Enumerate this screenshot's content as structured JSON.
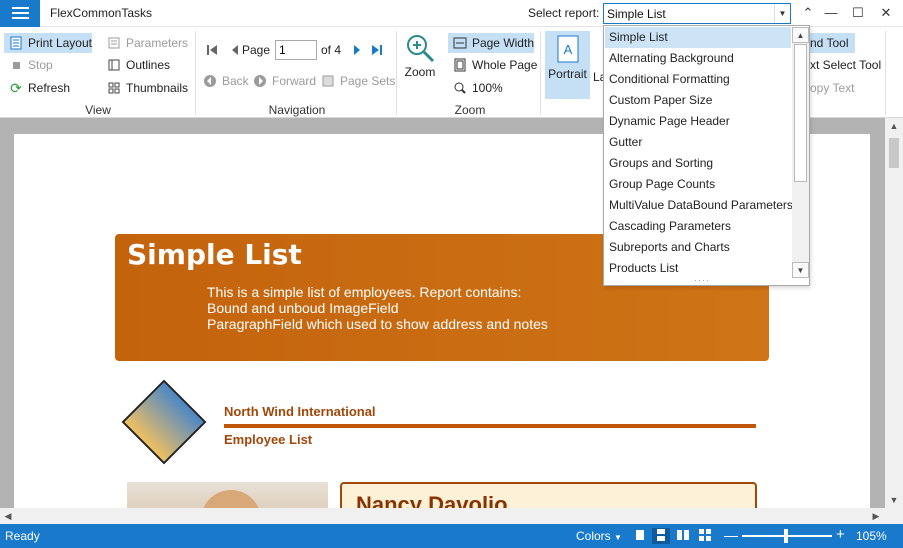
{
  "app": {
    "title": "FlexCommonTasks"
  },
  "header": {
    "select_label": "Select report:",
    "selected_report": "Simple List"
  },
  "ribbon": {
    "view": {
      "print_layout": "Print Layout",
      "stop": "Stop",
      "refresh": "Refresh",
      "parameters": "Parameters",
      "outlines": "Outlines",
      "thumbnails": "Thumbnails",
      "group_label": "View"
    },
    "navigation": {
      "page_label": "Page",
      "page_value": "1",
      "page_of": "of 4",
      "back": "Back",
      "forward": "Forward",
      "page_sets": "Page Sets",
      "group_label": "Navigation"
    },
    "zoom": {
      "zoom": "Zoom",
      "page_width": "Page Width",
      "whole_page": "Whole Page",
      "percent_100": "100%",
      "group_label": "Zoom"
    },
    "layout": {
      "portrait": "Portrait",
      "landscape_partial": "La"
    },
    "tools": {
      "hand_tool_partial": "nd Tool",
      "select_tool_partial": "xt Select Tool",
      "copy_text_partial": "opy Text"
    }
  },
  "dropdown": {
    "items": [
      "Simple List",
      "Alternating Background",
      "Conditional Formatting",
      "Custom Paper Size",
      "Dynamic Page Header",
      "Gutter",
      "Groups and Sorting",
      "Group Page Counts",
      "MultiValue DataBound Parameters",
      "Cascading Parameters",
      "Subreports and Charts",
      "Products List"
    ],
    "selected_index": 0
  },
  "report": {
    "banner_title": "Simple List",
    "banner_lines": [
      "This is a simple list of employees. Report contains:",
      "Bound and unboud ImageField",
      "ParagraphField which used to show address and notes"
    ],
    "company": "North Wind International",
    "subtitle": "Employee List",
    "employee_name": "Nancy Davolio"
  },
  "status": {
    "text": "Ready",
    "colors": "Colors",
    "zoom_value": "105%"
  },
  "colors": {
    "accent": "#1979ca",
    "banner": "#c3630c",
    "company_text": "#a0480a"
  }
}
